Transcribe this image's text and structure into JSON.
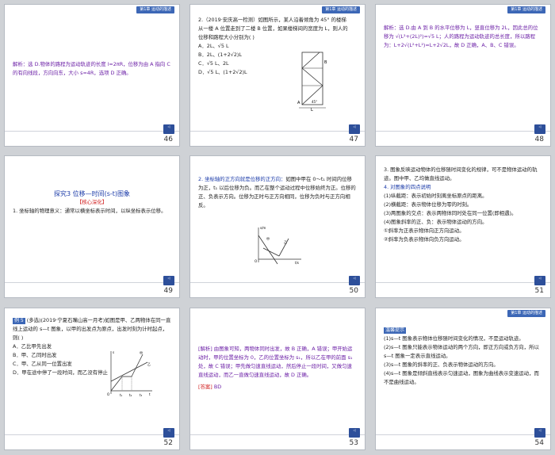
{
  "slides": [
    {
      "num": "46",
      "chip": "第1章 运动的描述",
      "text": "解析：选 D.物体的路程为运动轨迹的长度 l=2πR，位移为由 A 指向 C 的有向线段，方向向东，大小 s=4R，选项 D 正确。"
    },
    {
      "num": "47",
      "chip": "第1章 运动的描述",
      "question": "2.（2019·安庆高一检测）如图所示，某人沿着倾角为 45° 的楼梯从一楼 A 位置走到了二楼 B 位置，如果楼梯间的宽度为 L，则人的位移和路程大小分别为(      )",
      "options": [
        "A．2L、√5 L",
        "B．2L、(1+2√2)L",
        "C．√5 L、2L",
        "D．√5 L、(1+2√2)L"
      ],
      "fig_labels": {
        "A": "A",
        "B": "B",
        "angle": "45°",
        "L": "L"
      }
    },
    {
      "num": "48",
      "chip": "第1章 运动的描述",
      "text": "解析：选 D.由 A 到 B 的水平位移为 L，竖直位移为 2L，因此总的位移为 √(L²+(2L)²)=√5 L；人的路程为运动轨迹的总长度，所以路程为：L+2√(L²+L²)=L+2√2L，故 D 正确，A、B、C 错误。"
    },
    {
      "num": "49",
      "title": "探究3  位移—时间(s-t)图象",
      "subtitle": "【核心深化】",
      "text": "1. 坐标轴的物理意义：通常以横坐标表示时间，以纵坐标表示位移。"
    },
    {
      "num": "50",
      "text1": "2. 坐标轴的正方向就是位移的正方向：",
      "text2": "如图中甲在 0～t₁ 时间内位移为正，t₁ 以后位移为负。而乙在整个运动过程中位移始终为正。位移的正、负表示方向。位移为正时与正方向相同，位移为负时与正方向相反。",
      "fig_labels": {
        "s": "s/m",
        "t": "t/s",
        "jia": "甲",
        "yi": "乙",
        "o": "O"
      }
    },
    {
      "num": "51",
      "lines": [
        "3. 图象反映运动物体的位移随时间变化的规律，可不是物体运动的轨迹。图中甲、乙均做直线运动。",
        "4. 对图象的四点说明",
        "(1)纵截距：表示初始时刻离坐标原点的距离。",
        "(2)横截距：表示物体位移为零的时刻。",
        "(3)两图象的交点：表示两物体同时处在同一位置(即相遇)。",
        "(4)图象斜率的正、负：表示物体运动的方向。",
        "①斜率为正表示物体向正方向运动。",
        "②斜率为负表示物体向负方向运动。"
      ]
    },
    {
      "num": "52",
      "tag": "例 5",
      "question": "(多选)(2019·宁夏石嘴山高一月考)如图是甲、乙两物体在同一直线上运动的 s—t 图象，以甲的出发点为原点，出发时刻为计时起点，则(      )",
      "options": [
        "A．乙比甲先出发",
        "B．甲、乙同时出发",
        "C．甲、乙从同一位置出发",
        "D．甲在途中停了一段时间，而乙没有停止"
      ],
      "fig_labels": {
        "s": "s",
        "t": "t",
        "jia": "甲",
        "yi": "乙",
        "o": "O",
        "t1": "t₁",
        "t2": "t₂",
        "t3": "t₃"
      }
    },
    {
      "num": "53",
      "text": "[解析]  由图象可知，两物体同时出发，故 B 正确，A 错误；甲开始运动时，甲的位置坐标为 0，乙的位置坐标为 s₁，所以乙在甲的前面 s₁ 处，故 C 错误；甲先做匀速直线运动，然后停止一段时间，又做匀速直线运动，而乙一直做匀速直线运动，故 D 正确。",
      "answer_label": "[答案]",
      "answer": "BD"
    },
    {
      "num": "54",
      "chip": "第1章 运动的描述",
      "tag": "温馨提示",
      "lines": [
        "(1)s—t 图象表示物体位移随时间变化的情况，不是运动轨迹。",
        "(2)s—t 图象只能表示物体运动的两个方向，即正方向或负方向，所以 s—t 图象一定表示直线运动。",
        "(3)s—t 图象的斜率的正、负表示物体运动的方向。",
        "(4)s—t 图象是倾斜直线表示匀速运动，图象为曲线表示变速运动，而不是曲线运动。"
      ]
    }
  ],
  "back_label": "课时\n导航",
  "colors": {
    "bar": "#3c67b6",
    "purple": "#6b1fa6",
    "blue": "#1a3aa8"
  }
}
